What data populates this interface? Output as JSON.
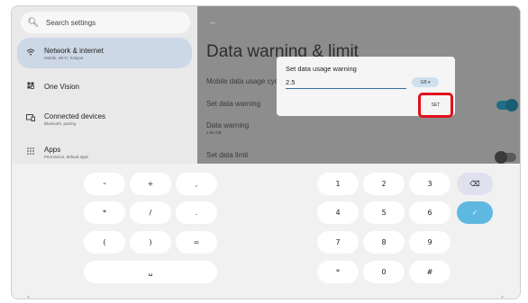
{
  "sidebar": {
    "search_placeholder": "Search settings",
    "items": [
      {
        "title": "Network & internet",
        "subtitle": "Mobile, Wi-Fi, hotspot"
      },
      {
        "title": "One Vision",
        "subtitle": ""
      },
      {
        "title": "Connected devices",
        "subtitle": "Bluetooth, pairing"
      },
      {
        "title": "Apps",
        "subtitle": "Permission, default apps"
      }
    ]
  },
  "page": {
    "back_glyph": "←",
    "title": "Data warning & limit",
    "rows": [
      {
        "title": "Mobile data usage cycle",
        "subtitle": ""
      },
      {
        "title": "Set data warning",
        "subtitle": ""
      },
      {
        "title": "Data warning",
        "subtitle": "2.00 GB"
      },
      {
        "title": "Set data limit",
        "subtitle": ""
      }
    ],
    "toggles": [
      {
        "label": "set-data-warning",
        "on": true
      },
      {
        "label": "set-data-limit",
        "on": false
      }
    ]
  },
  "dialog": {
    "title": "Set data usage warning",
    "value": "2.5",
    "unit": "GB ▾",
    "confirm_label": "SET"
  },
  "keyboard": {
    "left_keys": [
      "-",
      "+",
      ",",
      "*",
      "/",
      ".",
      "(",
      ")",
      "=",
      "␣"
    ],
    "right_keys": [
      "1",
      "2",
      "3",
      "4",
      "5",
      "6",
      "7",
      "8",
      "9",
      "*",
      "0",
      "#"
    ],
    "delete_glyph": "⌫",
    "done_glyph": "✓"
  },
  "colors": {
    "accent": "#1f6d86",
    "highlight": "#e0101b",
    "active_nav": "#cdd8e6",
    "done_key": "#5fb8e0"
  }
}
